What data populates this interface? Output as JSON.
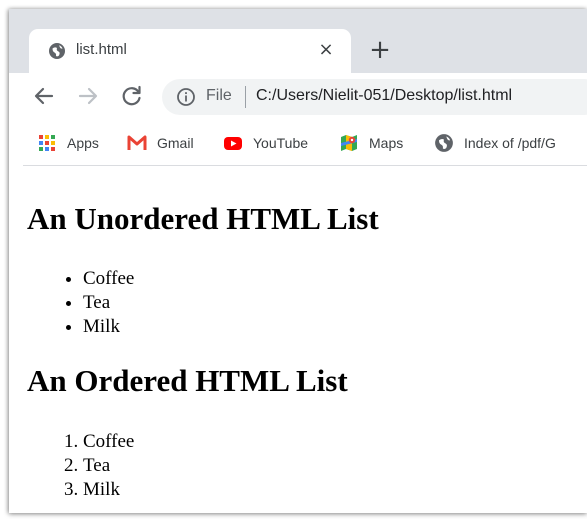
{
  "browser": {
    "tab": {
      "title": "list.html",
      "close_glyph": "×"
    },
    "new_tab_glyph": "+",
    "address_bar": {
      "scheme_label": "File",
      "url": "C:/Users/Nielit-051/Desktop/list.html"
    },
    "bookmarks": [
      {
        "label": "Apps",
        "icon": "apps-grid-icon"
      },
      {
        "label": "Gmail",
        "icon": "gmail-icon"
      },
      {
        "label": "YouTube",
        "icon": "youtube-icon"
      },
      {
        "label": "Maps",
        "icon": "maps-icon"
      },
      {
        "label": "Index of /pdf/G",
        "icon": "globe-icon"
      }
    ]
  },
  "page": {
    "unordered_heading": "An Unordered HTML List",
    "unordered_items": [
      "Coffee",
      "Tea",
      "Milk"
    ],
    "ordered_heading": "An Ordered HTML List",
    "ordered_items": [
      "Coffee",
      "Tea",
      "Milk"
    ]
  },
  "colors": {
    "tabstrip": "#dee1e6",
    "omnibox": "#f1f3f4",
    "gmail_red": "#ea4335",
    "youtube_red": "#ff0000"
  }
}
